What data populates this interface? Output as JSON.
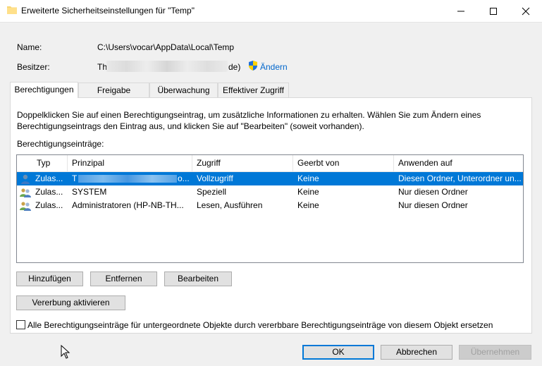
{
  "window": {
    "title": "Erweiterte Sicherheitseinstellungen für \"Temp\"",
    "controls": [
      "minimize-icon",
      "maximize-icon",
      "close-icon"
    ]
  },
  "info": {
    "name_label": "Name:",
    "name_value": "C:\\Users\\vocar\\AppData\\Local\\Temp",
    "owner_label": "Besitzer:",
    "owner_prefix": "Th",
    "owner_suffix": "de)",
    "change_link": "Ändern"
  },
  "tabs": [
    {
      "label": "Berechtigungen",
      "active": true
    },
    {
      "label": "Freigabe",
      "active": false
    },
    {
      "label": "Überwachung",
      "active": false
    },
    {
      "label": "Effektiver Zugriff",
      "active": false
    }
  ],
  "panel": {
    "description": "Doppelklicken Sie auf einen Berechtigungseintrag, um zusätzliche Informationen zu erhalten. Wählen Sie zum Ändern eines Berechtigungseintrags den Eintrag aus, und klicken Sie auf \"Bearbeiten\" (soweit vorhanden).",
    "list_label": "Berechtigungseinträge:"
  },
  "table": {
    "columns": [
      "Typ",
      "Prinzipal",
      "Zugriff",
      "Geerbt von",
      "Anwenden auf"
    ],
    "rows": [
      {
        "typ": "Zulas...",
        "prinzipal": "T",
        "prinzipal_suffix": "o...",
        "zugriff": "Vollzugriff",
        "geerbt": "Keine",
        "anwenden": "Diesen Ordner, Unterordner un...",
        "selected": true
      },
      {
        "typ": "Zulas...",
        "prinzipal": "SYSTEM",
        "prinzipal_suffix": "",
        "zugriff": "Speziell",
        "geerbt": "Keine",
        "anwenden": "Nur diesen Ordner",
        "selected": false
      },
      {
        "typ": "Zulas...",
        "prinzipal": "Administratoren (HP-NB-TH...",
        "prinzipal_suffix": "",
        "zugriff": "Lesen, Ausführen",
        "geerbt": "Keine",
        "anwenden": "Nur diesen Ordner",
        "selected": false
      }
    ]
  },
  "buttons": {
    "add": "Hinzufügen",
    "remove": "Entfernen",
    "edit": "Bearbeiten",
    "inheritance": "Vererbung aktivieren",
    "ok": "OK",
    "cancel": "Abbrechen",
    "apply": "Übernehmen"
  },
  "checkbox": {
    "label": "Alle Berechtigungseinträge für untergeordnete Objekte durch vererbbare Berechtigungseinträge von diesem Objekt ersetzen",
    "checked": false
  },
  "colors": {
    "selection": "#0078d7",
    "link": "#0066cc"
  }
}
